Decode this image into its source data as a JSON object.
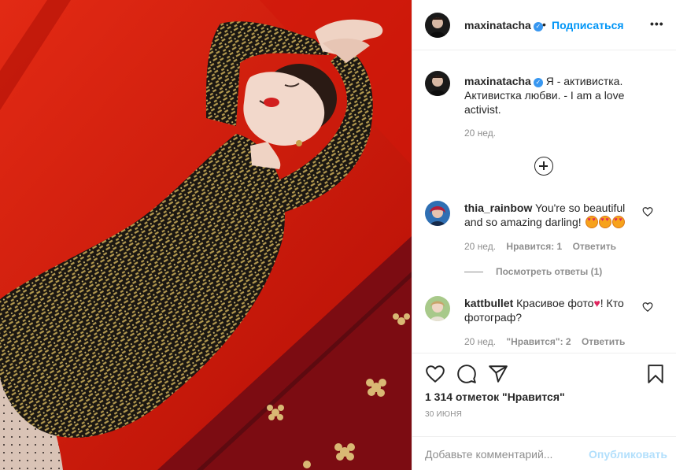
{
  "post": {
    "author": "maxinatacha",
    "verified_mark": "✓",
    "dot": "•",
    "follow_label": "Подписаться",
    "more_label": "•••",
    "caption": "Я - активистка. Активистка любви. - I am a love activist.",
    "caption_time": "20 нед."
  },
  "comments": [
    {
      "user": "thia_rainbow",
      "text": "You're so beautiful and so amazing darling!",
      "time": "20 нед.",
      "likes": "Нравится: 1",
      "reply": "Ответить",
      "view_replies": "Посмотреть ответы (1)"
    },
    {
      "user": "kattbullet",
      "text_before": "Красивое фото",
      "heart": "♥",
      "text_after": "! Кто фотограф?",
      "time": "20 нед.",
      "likes": "\"Нравится\": 2",
      "reply": "Ответить"
    }
  ],
  "actions": {
    "likes_count": "1 314 отметок \"Нравится\"",
    "date": "30 ИЮНЯ",
    "comment_placeholder": "Добавьте комментарий...",
    "publish_label": "Опубликовать"
  },
  "colors": {
    "accent": "#0095f6",
    "sofa": "#c81408",
    "dress_gold": "#b3994f",
    "dress_black": "#1b1712"
  },
  "icons": [
    "plus-circle-icon",
    "heart-icon",
    "comment-icon",
    "share-icon",
    "bookmark-icon",
    "verified-icon",
    "more-icon"
  ]
}
